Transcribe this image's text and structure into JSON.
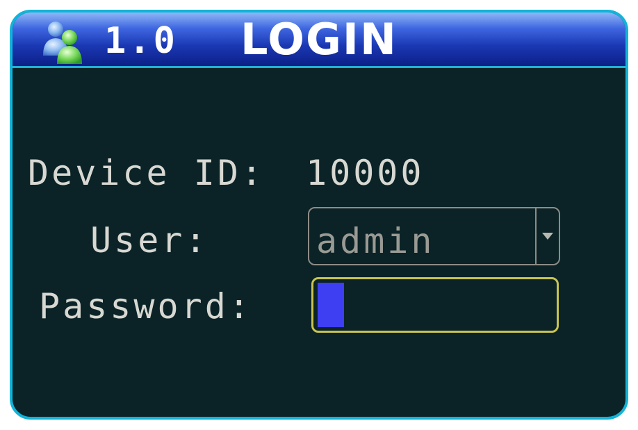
{
  "header": {
    "icon": "users-icon",
    "version": "1.0",
    "title": "LOGIN"
  },
  "form": {
    "device_id_label": "Device ID:",
    "device_id_value": "10000",
    "user_label": "User:",
    "user_value": "admin",
    "user_dropdown_icon": "chevron-down-icon",
    "password_label": "Password:",
    "password_value": ""
  },
  "colors": {
    "background": "#0b2327",
    "frame": "#12b4d8",
    "titlebar": "#1b38b4",
    "focus_border": "#c9c44e",
    "cursor": "#3e3ef2"
  }
}
